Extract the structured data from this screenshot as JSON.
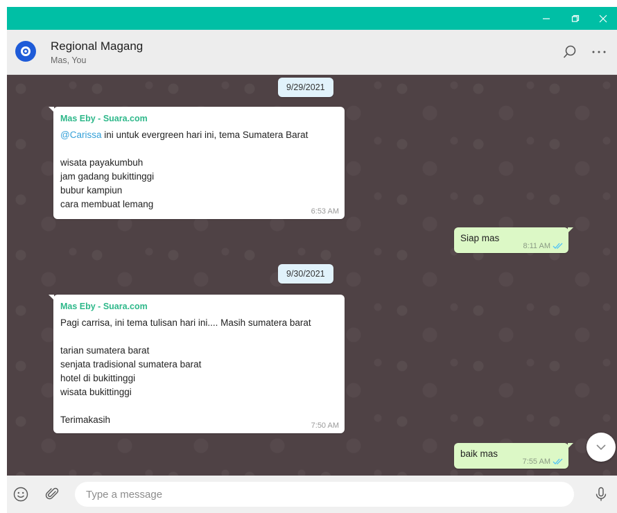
{
  "window": {
    "minimize_icon": "minimize-icon",
    "restore_icon": "restore-icon",
    "close_icon": "close-icon",
    "accent": "#00bfa5"
  },
  "header": {
    "title": "Regional Magang",
    "subtitle": "Mas, You",
    "search_icon": "search-icon",
    "menu_icon": "more-horizontal-icon"
  },
  "messages": {
    "date1": "9/29/2021",
    "msg1": {
      "sender": "Mas Eby - Suara.com",
      "mention": "@Carissa",
      "line1_rest": " ini untuk evergreen hari ini, tema Sumatera Barat",
      "line3": "wisata payakumbuh",
      "line4": "jam gadang bukittinggi",
      "line5": "bubur kampiun",
      "line6": "cara membuat lemang",
      "time": "6:53 AM"
    },
    "reply1": {
      "text": "Siap mas",
      "time": "8:11 AM"
    },
    "date2": "9/30/2021",
    "msg2": {
      "sender": "Mas Eby - Suara.com",
      "line1": "Pagi carrisa, ini tema tulisan hari ini.... Masih sumatera barat",
      "line3": "tarian sumatera barat",
      "line4": "senjata tradisional sumatera barat",
      "line5": "hotel di bukittinggi",
      "line6": "wisata bukittinggi",
      "line8": "Terimakasih",
      "time": "7:50 AM"
    },
    "reply2": {
      "text": "baik mas",
      "time": "7:55 AM"
    }
  },
  "composer": {
    "placeholder": "Type a message",
    "emoji_icon": "emoji-icon",
    "attach_icon": "paperclip-icon",
    "mic_icon": "microphone-icon"
  },
  "colors": {
    "chat_bg": "#4f4245",
    "out_bubble": "#dcf8c6",
    "sender_name": "#2eb88a",
    "read_ticks": "#4fc3f7"
  }
}
